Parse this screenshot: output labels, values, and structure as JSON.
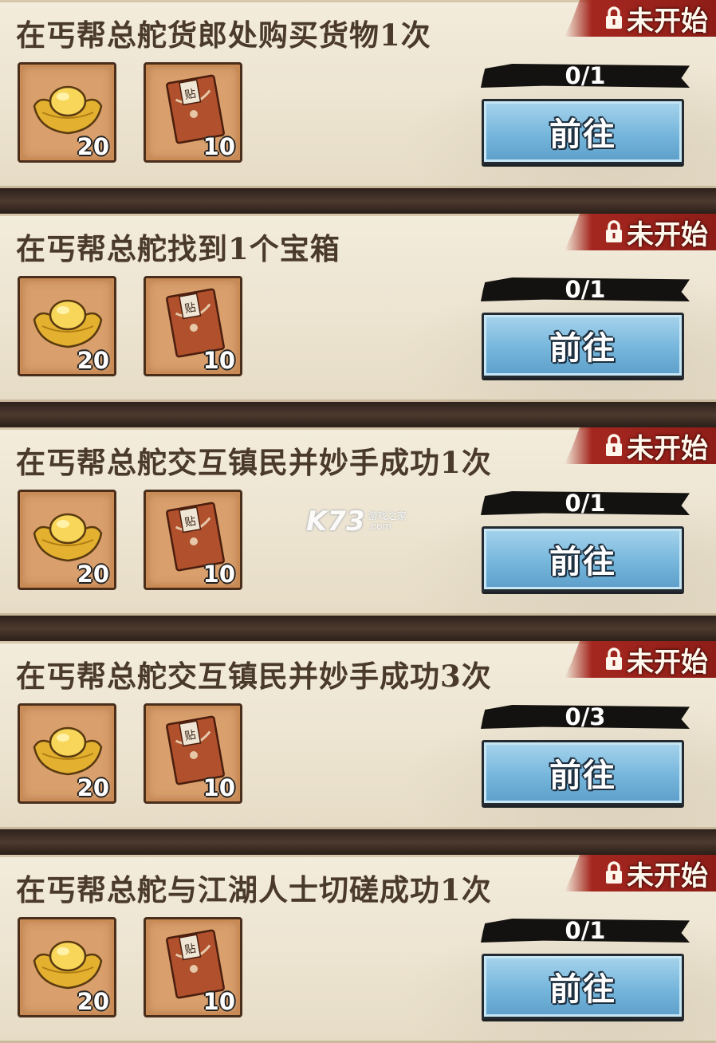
{
  "tasks": [
    {
      "title": "在丐帮总舵货郎处购买货物1次",
      "status": "未开始",
      "rewards": [
        {
          "icon": "gold-ingot",
          "count": "20"
        },
        {
          "icon": "red-envelope",
          "count": "10"
        }
      ],
      "progress": "0/1",
      "button": "前往"
    },
    {
      "title": "在丐帮总舵找到1个宝箱",
      "status": "未开始",
      "rewards": [
        {
          "icon": "gold-ingot",
          "count": "20"
        },
        {
          "icon": "red-envelope",
          "count": "10"
        }
      ],
      "progress": "0/1",
      "button": "前往"
    },
    {
      "title": "在丐帮总舵交互镇民并妙手成功1次",
      "status": "未开始",
      "rewards": [
        {
          "icon": "gold-ingot",
          "count": "20"
        },
        {
          "icon": "red-envelope",
          "count": "10"
        }
      ],
      "progress": "0/1",
      "button": "前往"
    },
    {
      "title": "在丐帮总舵交互镇民并妙手成功3次",
      "status": "未开始",
      "rewards": [
        {
          "icon": "gold-ingot",
          "count": "20"
        },
        {
          "icon": "red-envelope",
          "count": "10"
        }
      ],
      "progress": "0/3",
      "button": "前往"
    },
    {
      "title": "在丐帮总舵与江湖人士切磋成功1次",
      "status": "未开始",
      "rewards": [
        {
          "icon": "gold-ingot",
          "count": "20"
        },
        {
          "icon": "red-envelope",
          "count": "10"
        }
      ],
      "progress": "0/1",
      "button": "前往"
    }
  ],
  "envelope_glyph": "贴",
  "watermark": {
    "logo": "K73",
    "cn": "游戏之家",
    "domain": ".com"
  },
  "colors": {
    "card_bg": "#ece3cf",
    "title_text": "#4a3a2c",
    "status_red": "#a4271f",
    "button_blue": "#76b6dc",
    "reward_bg": "#d99f6c",
    "divider": "#3b2a22"
  }
}
